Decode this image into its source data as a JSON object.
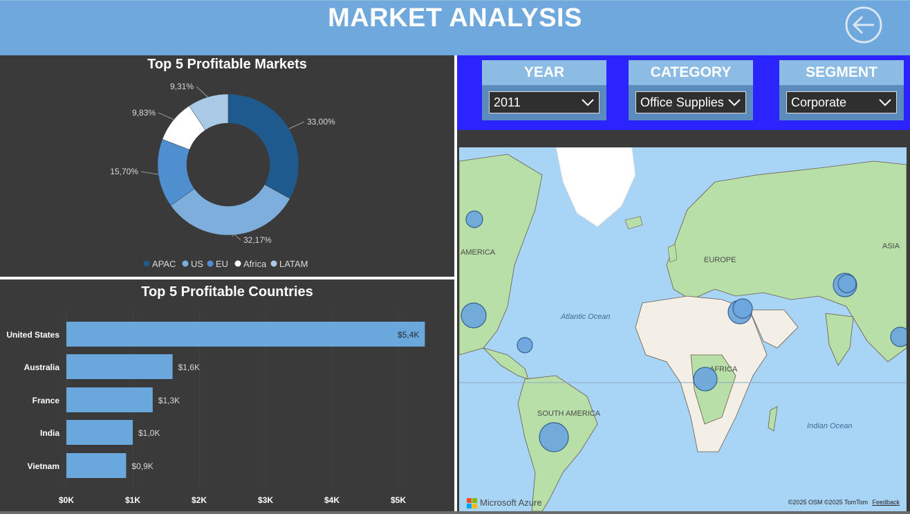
{
  "header": {
    "title": "MARKET ANALYSIS",
    "back_icon": "back-arrow-icon"
  },
  "slicers": [
    {
      "id": "year",
      "label": "YEAR",
      "value": "2011"
    },
    {
      "id": "category",
      "label": "CATEGORY",
      "value": "Office Supplies"
    },
    {
      "id": "segment",
      "label": "SEGMENT",
      "value": "Corporate"
    }
  ],
  "colors": {
    "apac": "#1f5a8f",
    "us": "#7eaedb",
    "eu": "#4f8fcf",
    "africa": "#ffffff",
    "latam": "#a9c9e6",
    "bar": "#6aa7dc",
    "slicer_bg": "#2b24ff"
  },
  "chart_data": [
    {
      "type": "pie",
      "title": "Top 5 Profitable Markets",
      "categories": [
        "APAC",
        "US",
        "EU",
        "Africa",
        "LATAM"
      ],
      "values": [
        33.0,
        32.17,
        15.7,
        9.83,
        9.31
      ],
      "data_labels": [
        "33,00%",
        "32,17%",
        "15,70%",
        "9,83%",
        "9,31%"
      ],
      "legend": "bottom"
    },
    {
      "type": "bar",
      "title": "Top 5 Profitable Countries",
      "categories": [
        "United States",
        "Australia",
        "France",
        "India",
        "Vietnam"
      ],
      "values": [
        5.4,
        1.6,
        1.3,
        1.0,
        0.9
      ],
      "data_labels": [
        "$5,4K",
        "$1,6K",
        "$1,3K",
        "$1,0K",
        "$0,9K"
      ],
      "xlim": [
        0,
        5.5
      ],
      "x_ticks": [
        "$0K",
        "$1K",
        "$2K",
        "$3K",
        "$4K",
        "$5K"
      ],
      "grid": true
    }
  ],
  "map": {
    "labels": [
      "AMERICA",
      "EUROPE",
      "ASIA",
      "Atlantic Ocean",
      "AFRICA",
      "SOUTH AMERICA",
      "Indian Ocean"
    ],
    "attribution": "©2025 OSM  ©2025 TomTom",
    "feedback": "Feedback",
    "provider": "Microsoft Azure"
  }
}
